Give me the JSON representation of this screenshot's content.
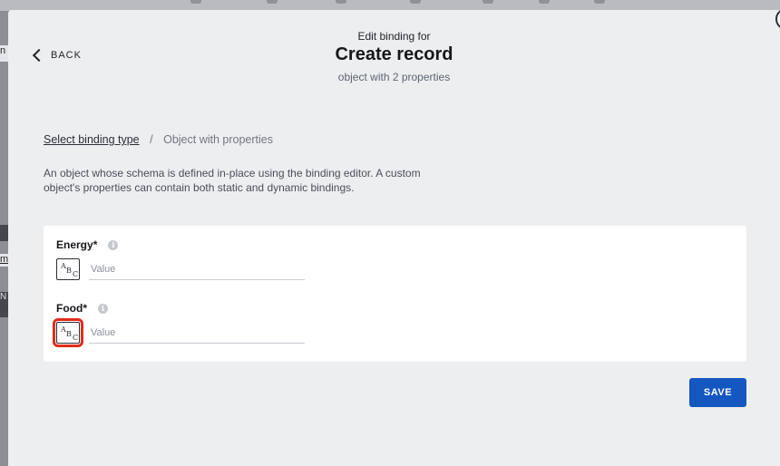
{
  "header": {
    "pretitle": "Edit binding for",
    "title": "Create record",
    "subtitle": "object with 2 properties"
  },
  "nav": {
    "back_label": "BACK"
  },
  "breadcrumb": {
    "link": "Select binding type",
    "separator": "/",
    "current": "Object with properties"
  },
  "description": "An object whose schema is defined in-place using the binding editor. A custom object's properties can contain both static and dynamic bindings.",
  "fields": [
    {
      "label": "Energy",
      "required_mark": "*",
      "type_icon": "abc-text-type-icon",
      "placeholder": "Value",
      "value": ""
    },
    {
      "label": "Food",
      "required_mark": "*",
      "type_icon": "abc-text-type-icon",
      "placeholder": "Value",
      "value": ""
    }
  ],
  "actions": {
    "save_label": "SAVE"
  },
  "colors": {
    "primary": "#1557c0",
    "highlight": "#e12d1d",
    "modal_bg": "#edeef0"
  }
}
